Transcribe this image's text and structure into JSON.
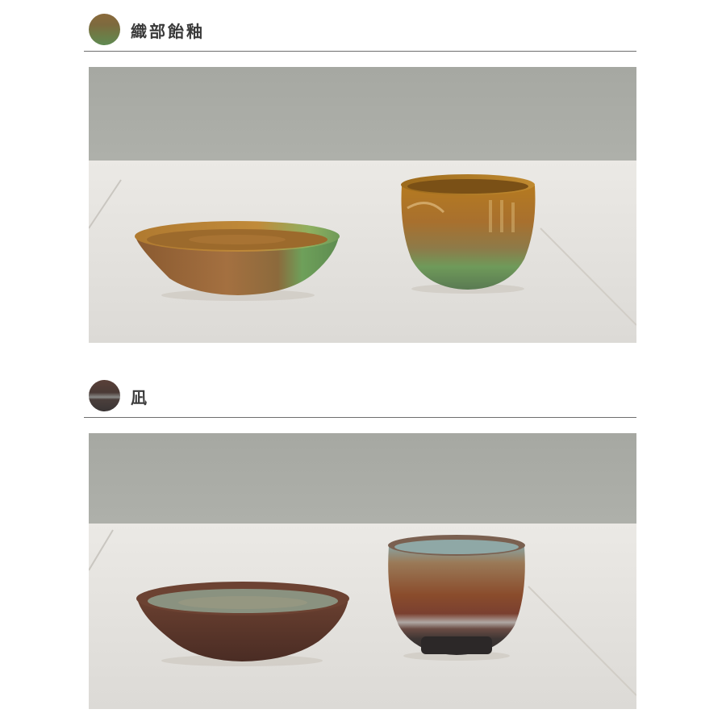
{
  "sections": [
    {
      "title": "織部飴釉",
      "swatch_icon": "glaze-swatch-oribe",
      "colors": {
        "swatch_top": "#8a6a3c",
        "swatch_bottom": "#5f8a52"
      }
    },
    {
      "title": "凪",
      "swatch_icon": "glaze-swatch-nagi",
      "colors": {
        "swatch_top": "#5a4038",
        "swatch_bottom": "#3a3535"
      }
    }
  ],
  "colors": {
    "page_background": "#ffffff",
    "divider": "#6e6e6e",
    "wall": "#a9aba5",
    "table": "#e4e2de"
  }
}
